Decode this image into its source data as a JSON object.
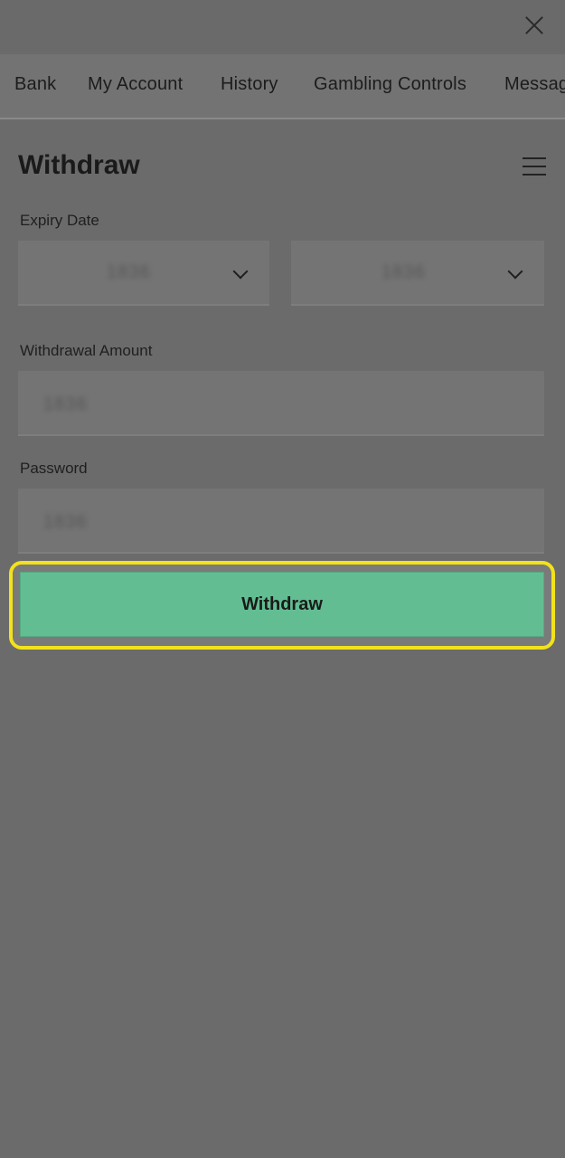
{
  "tabs": [
    {
      "label": "Bank"
    },
    {
      "label": "My Account"
    },
    {
      "label": "History"
    },
    {
      "label": "Gambling Controls"
    },
    {
      "label": "Messages"
    }
  ],
  "page_title": "Withdraw",
  "form": {
    "expiry_label": "Expiry Date",
    "expiry_month_value": "1836",
    "expiry_year_value": "1836",
    "amount_label": "Withdrawal Amount",
    "amount_value": "1836",
    "password_label": "Password",
    "password_value": "1836"
  },
  "submit_label": "Withdraw",
  "colors": {
    "overlay_gray": "#6b6b6b",
    "button_green": "#62be92",
    "highlight_yellow": "#f2e21b"
  },
  "icons": {
    "close": "close-icon",
    "menu": "hamburger-menu-icon",
    "dropdown": "chevron-down-icon"
  }
}
